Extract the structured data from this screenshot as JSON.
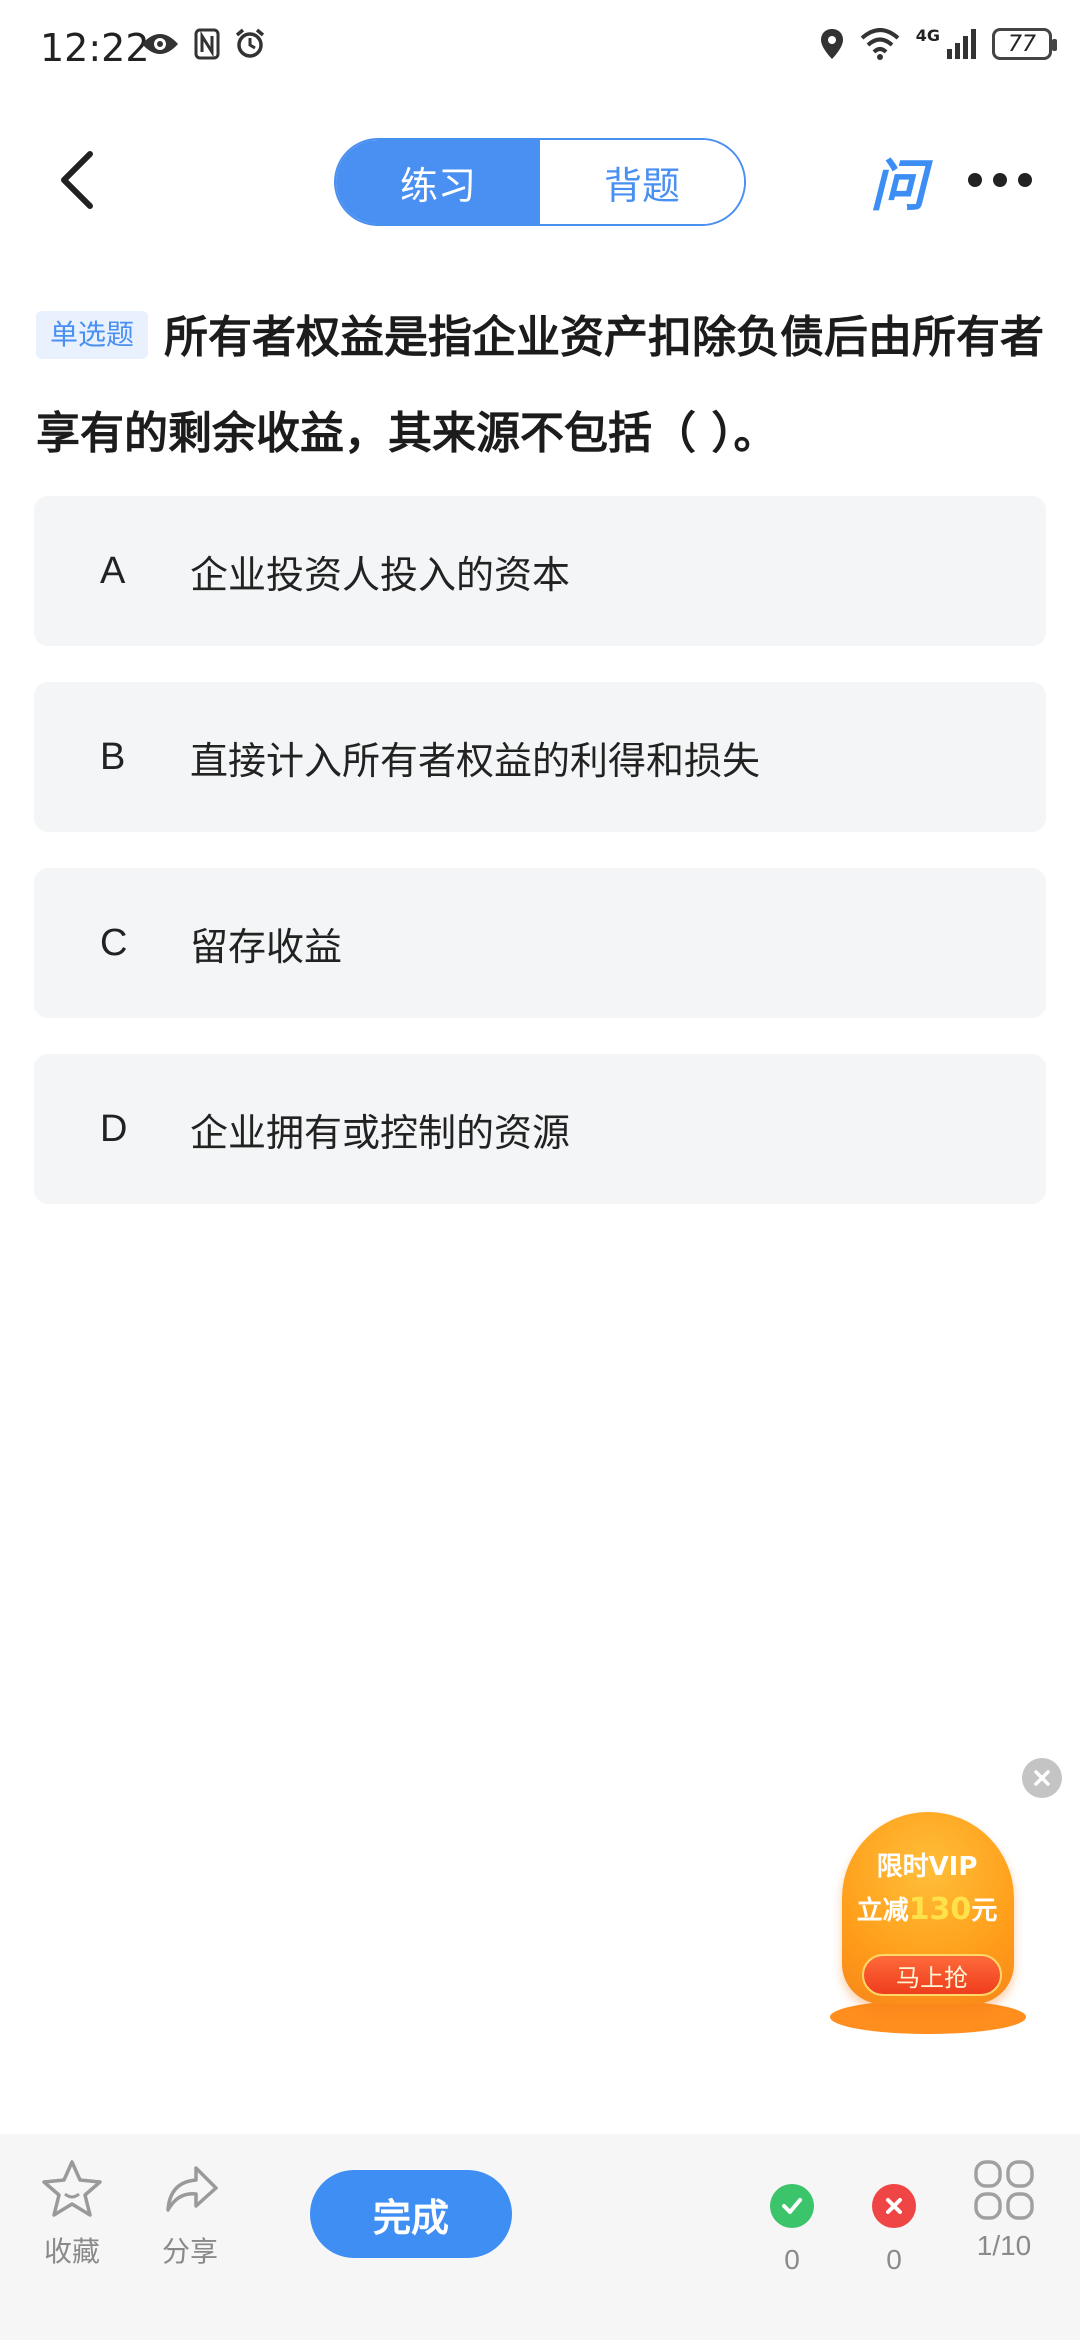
{
  "status_bar": {
    "time": "12:22",
    "network": "4G",
    "battery": "77"
  },
  "header": {
    "tabs": [
      {
        "label": "练习",
        "active": true
      },
      {
        "label": "背题",
        "active": false
      }
    ],
    "ask_logo": "问"
  },
  "question": {
    "type_tag": "单选题",
    "text": "所有者权益是指企业资产扣除负债后由所有者享有的剩余收益，其来源不包括（ ）。"
  },
  "options": [
    {
      "key": "A",
      "text": "企业投资人投入的资本"
    },
    {
      "key": "B",
      "text": "直接计入所有者权益的利得和损失"
    },
    {
      "key": "C",
      "text": "留存收益"
    },
    {
      "key": "D",
      "text": "企业拥有或控制的资源"
    }
  ],
  "promo": {
    "line1": "限时VIP",
    "line2_prefix": "立减",
    "line2_amount": "130",
    "line2_suffix": "元",
    "button": "马上抢"
  },
  "bottom_bar": {
    "favorite_label": "收藏",
    "share_label": "分享",
    "done_label": "完成",
    "correct_count": "0",
    "wrong_count": "0",
    "progress": "1/10"
  },
  "colors": {
    "accent": "#4a8ff2",
    "correct": "#3cc46a",
    "wrong": "#ef4545",
    "promo": "#ff9e1a"
  }
}
